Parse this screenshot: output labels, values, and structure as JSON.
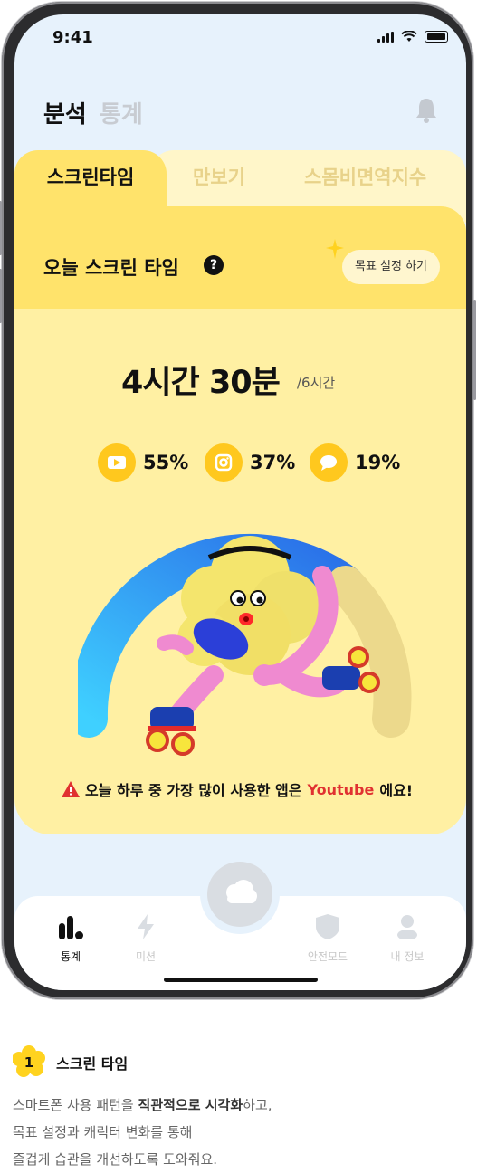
{
  "status": {
    "time": "9:41"
  },
  "header": {
    "title": "분석",
    "subtitle": "통계"
  },
  "tabs": [
    {
      "label": "스크린타임",
      "active": true
    },
    {
      "label": "만보기",
      "active": false
    },
    {
      "label": "스몸비면역지수",
      "active": false
    }
  ],
  "card": {
    "title": "오늘 스크린 타임",
    "help": "?",
    "goal_button": "목표 설정 하기",
    "time_used": "4시간 30분",
    "time_goal": "/6시간",
    "usage": [
      {
        "icon": "youtube-icon",
        "percent": "55%"
      },
      {
        "icon": "instagram-icon",
        "percent": "37%"
      },
      {
        "icon": "chat-icon",
        "percent": "19%"
      }
    ],
    "warning_prefix": "오늘 하루 중 가장 많이 사용한 앱은",
    "warning_app": "Youtube",
    "warning_suffix": "에요!"
  },
  "nav": [
    {
      "label": "통계",
      "icon": "bar-chart-icon",
      "active": true
    },
    {
      "label": "미션",
      "icon": "lightning-icon",
      "active": false
    },
    {
      "label": "안전모드",
      "icon": "shield-icon",
      "active": false
    },
    {
      "label": "내 정보",
      "icon": "person-icon",
      "active": false
    }
  ],
  "caption": {
    "number": "1",
    "title": "스크린 타임",
    "line1_pre": "스마트폰 사용 패턴을",
    "line1_bold": "직관적으로 시각화",
    "line1_post": "하고,",
    "line2": "목표 설정과 캐릭터 변화를 통해",
    "line3": "즐겁게 습관을 개선하도록 도와줘요."
  },
  "colors": {
    "accent": "#ffe36b",
    "card": "#fff0a3",
    "icon_bg": "#ffc81e",
    "warning": "#e03131"
  }
}
